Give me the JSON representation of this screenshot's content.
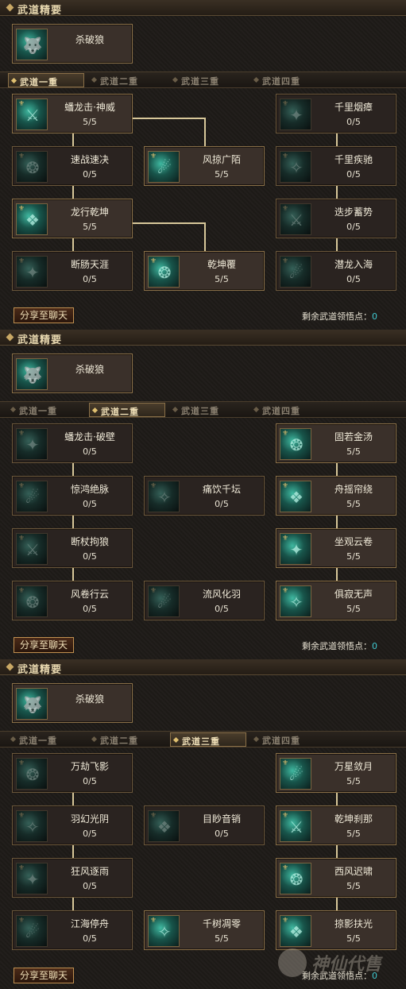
{
  "header_title": "武道精要",
  "core_skill": "杀破狼",
  "tabs": [
    "武道一重",
    "武道二重",
    "武道三重",
    "武道四重"
  ],
  "share_label": "分享至聊天",
  "remain_label": "剩余武道领悟点：",
  "remain_value": "0",
  "watermark": "神仙代售",
  "panels": [
    {
      "active_tab": 0,
      "skills": {
        "r1c1": {
          "name": "蟠龙击·神威",
          "value": "5/5"
        },
        "r1c3": {
          "name": "千里烟瘴",
          "value": "0/5"
        },
        "r2c1": {
          "name": "速战速决",
          "value": "0/5"
        },
        "r2c2": {
          "name": "风掠广陌",
          "value": "5/5"
        },
        "r2c3": {
          "name": "千里疾驰",
          "value": "0/5"
        },
        "r3c1": {
          "name": "龙行乾坤",
          "value": "5/5"
        },
        "r3c3": {
          "name": "迭步蓄势",
          "value": "0/5"
        },
        "r4c1": {
          "name": "断肠天涯",
          "value": "0/5"
        },
        "r4c2": {
          "name": "乾坤覆",
          "value": "5/5"
        },
        "r4c3": {
          "name": "潜龙入海",
          "value": "0/5"
        }
      }
    },
    {
      "active_tab": 1,
      "skills": {
        "r1c1": {
          "name": "蟠龙击·破壁",
          "value": "0/5"
        },
        "r1c3": {
          "name": "固若金汤",
          "value": "5/5"
        },
        "r2c1": {
          "name": "惊鸿绝脉",
          "value": "0/5"
        },
        "r2c2": {
          "name": "痛饮千坛",
          "value": "0/5"
        },
        "r2c3": {
          "name": "舟摇帘绕",
          "value": "5/5"
        },
        "r3c1": {
          "name": "断杖拘狼",
          "value": "0/5"
        },
        "r3c3": {
          "name": "坐观云卷",
          "value": "5/5"
        },
        "r4c1": {
          "name": "风卷行云",
          "value": "0/5"
        },
        "r4c2": {
          "name": "流风化羽",
          "value": "0/5"
        },
        "r4c3": {
          "name": "俱寂无声",
          "value": "5/5"
        }
      }
    },
    {
      "active_tab": 2,
      "skills": {
        "r1c1": {
          "name": "万劫飞影",
          "value": "0/5"
        },
        "r1c3": {
          "name": "万星敛月",
          "value": "5/5"
        },
        "r2c1": {
          "name": "羽幻光阴",
          "value": "0/5"
        },
        "r2c2": {
          "name": "目眇音销",
          "value": "0/5"
        },
        "r2c3": {
          "name": "乾坤刹那",
          "value": "5/5"
        },
        "r3c1": {
          "name": "狂风逐雨",
          "value": "0/5"
        },
        "r3c3": {
          "name": "西风迟啸",
          "value": "5/5"
        },
        "r4c1": {
          "name": "江海停舟",
          "value": "0/5"
        },
        "r4c2": {
          "name": "千树凋零",
          "value": "5/5"
        },
        "r4c3": {
          "name": "掠影扶光",
          "value": "5/5"
        }
      }
    }
  ]
}
